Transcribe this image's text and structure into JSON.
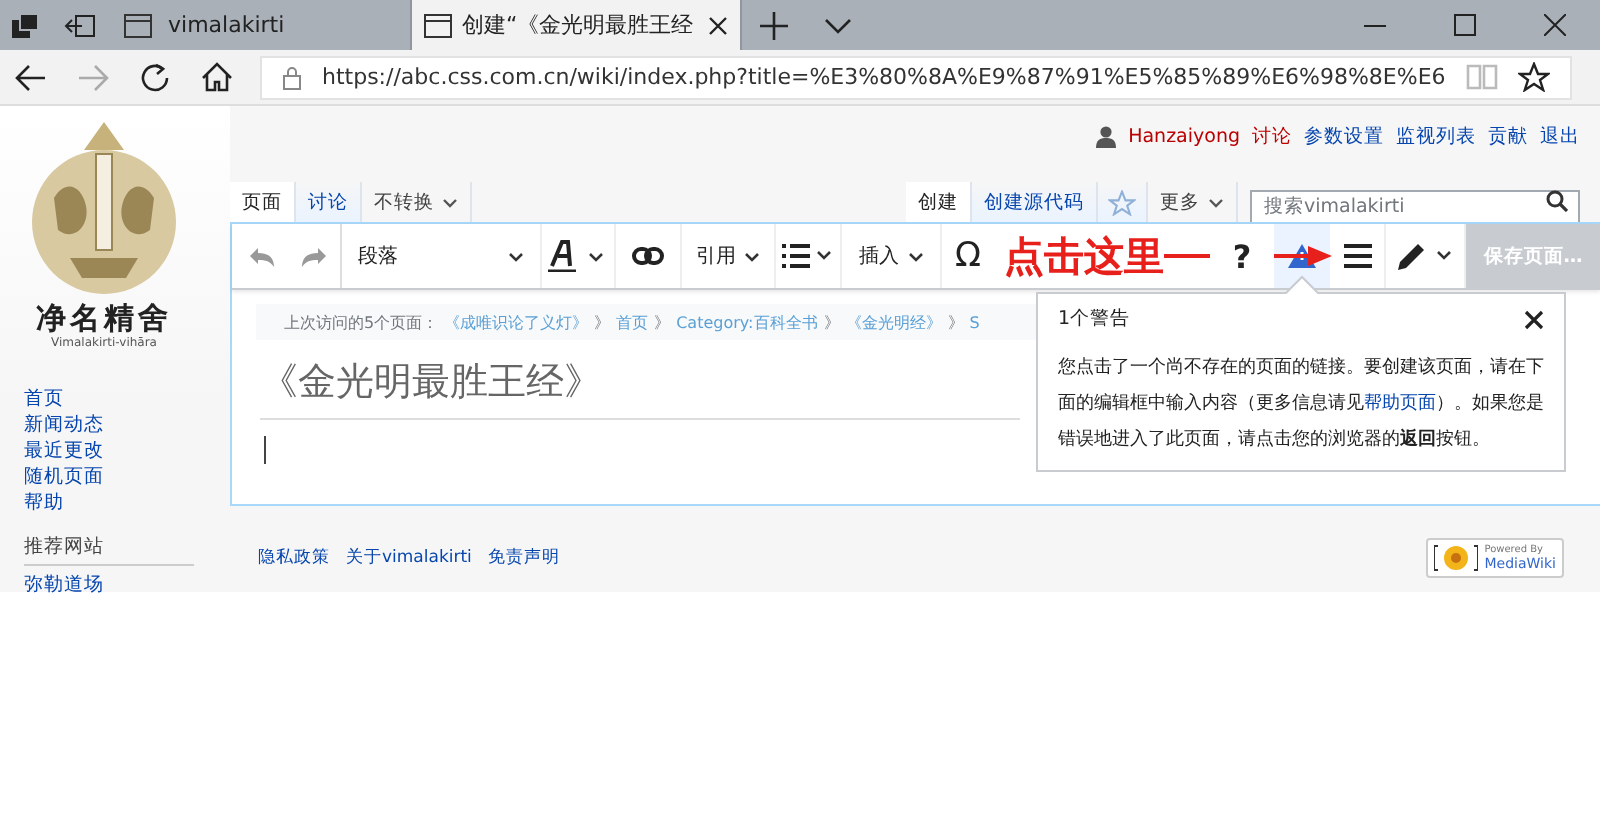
{
  "browser": {
    "tabs": [
      {
        "title": "vimalakirti",
        "selected": false
      },
      {
        "title": "创建“《金光明最胜王经",
        "selected": true
      }
    ],
    "url": "https://abc.css.com.cn/wiki/index.php?title=%E3%80%8A%E9%87%91%E5%85%89%E6%98%8E%E6",
    "forward_enabled": false
  },
  "site": {
    "logo_title": "净名精舍",
    "logo_subtitle": "Vimalakirti-vihāra"
  },
  "sidebar": {
    "nav": [
      "首页",
      "新闻动态",
      "最近更改",
      "随机页面",
      "帮助"
    ],
    "section_title": "推荐网站",
    "section_items": [
      "弥勒道场"
    ]
  },
  "personal_tools": {
    "user": "Hanzaiyong",
    "links": [
      {
        "label": "讨论",
        "exists": false
      },
      {
        "label": "参数设置",
        "exists": true
      },
      {
        "label": "监视列表",
        "exists": true
      },
      {
        "label": "贡献",
        "exists": true
      },
      {
        "label": "退出",
        "exists": true
      }
    ]
  },
  "page_tabs": [
    {
      "label": "页面",
      "selected": true
    },
    {
      "label": "讨论",
      "selected": false
    }
  ],
  "variant": "不转换",
  "action_tabs": [
    {
      "label": "创建",
      "selected": true
    },
    {
      "label": "创建源代码",
      "selected": false
    }
  ],
  "more": "更多",
  "search": {
    "placeholder": "搜索vimalakirti"
  },
  "toolbar": {
    "format": "段落",
    "cite": "引用",
    "insert": "插入",
    "special_char": "Ω",
    "help": "?",
    "notices_active": true,
    "save": "保存页面…",
    "save_enabled": false
  },
  "annotation": {
    "text": "点击这里"
  },
  "breadcrumb": {
    "label": "上次访问的5个页面：",
    "items": [
      {
        "label": "《成唯识论了义灯》",
        "separator": "》"
      },
      {
        "label": "首页",
        "separator": "》"
      },
      {
        "label": "Category:百科全书",
        "separator": "》"
      },
      {
        "label": "《金光明经》",
        "separator": "》"
      },
      {
        "label": "S"
      }
    ]
  },
  "title": "《金光明最胜王经》",
  "popup": {
    "title": "1个警告",
    "text_before": "您点击了一个尚不存在的页面的链接。要创建该页面，请在下面的编辑框中输入内容（更多信息请见",
    "link": "帮助页面",
    "text_after": "）。如果您是错误地进入了此页面，请点击您的浏览器的**返回**按钮。"
  },
  "footer": {
    "links": [
      "隐私政策",
      "关于vimalakirti",
      "免责声明"
    ],
    "badge_top": "Powered By",
    "badge_bottom": "MediaWiki"
  }
}
